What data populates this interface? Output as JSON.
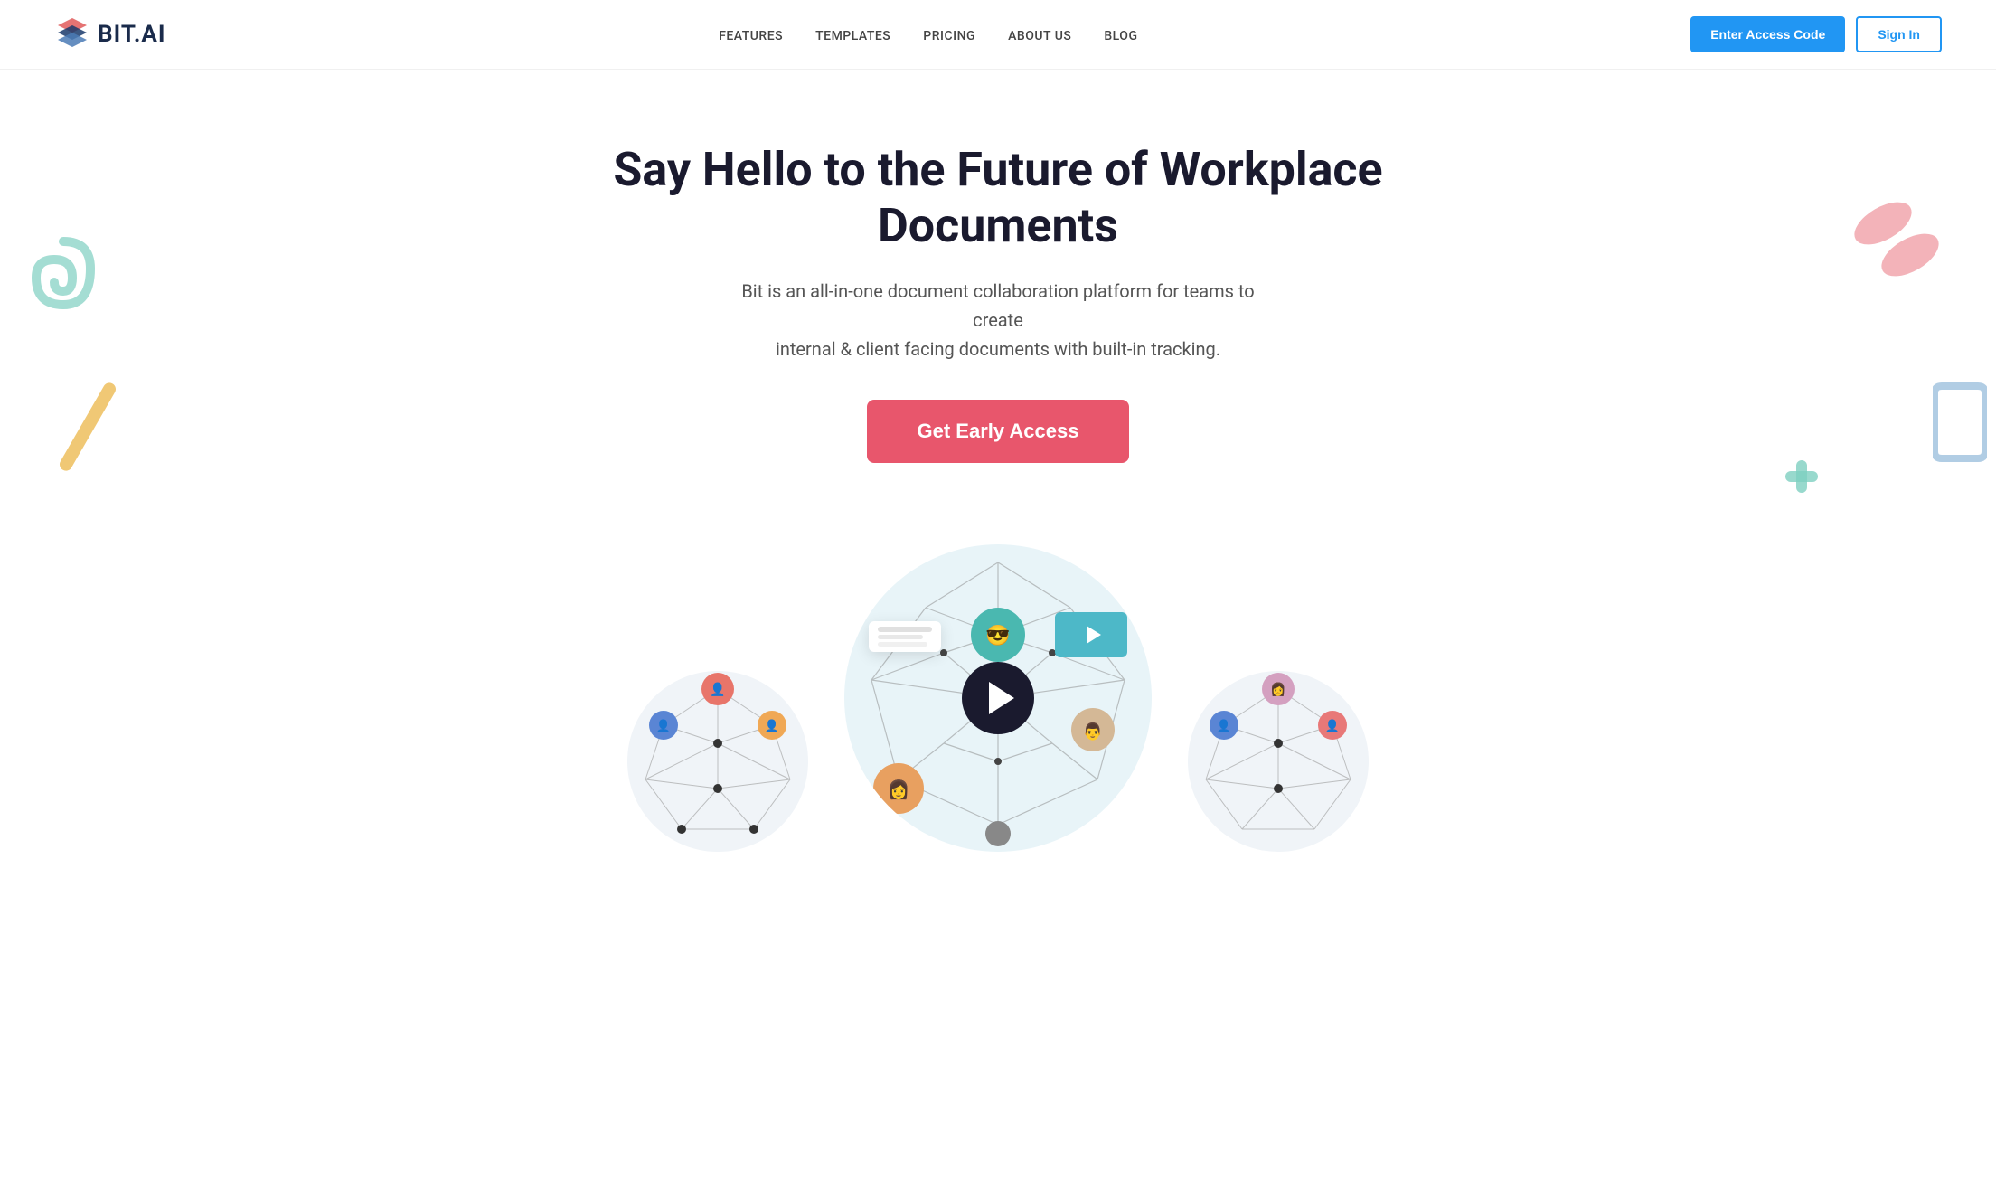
{
  "brand": {
    "logo_text": "BIT.AI",
    "tagline": "BIT.AI"
  },
  "nav": {
    "links": [
      {
        "id": "features",
        "label": "FEATURES"
      },
      {
        "id": "templates",
        "label": "TEMPLATES"
      },
      {
        "id": "pricing",
        "label": "PRICING"
      },
      {
        "id": "about",
        "label": "ABOUT US"
      },
      {
        "id": "blog",
        "label": "BLOG"
      }
    ],
    "cta_button": "Enter Access Code",
    "signin_button": "Sign In"
  },
  "hero": {
    "title": "Say Hello to the Future of Workplace Documents",
    "subtitle_line1": "Bit is an all-in-one document collaboration platform for teams to create",
    "subtitle_line2": "internal & client facing documents with built-in tracking.",
    "cta_label": "Get Early Access"
  },
  "colors": {
    "brand_blue": "#2196f3",
    "brand_dark": "#1a2b4b",
    "cta_pink": "#e8566c",
    "deco_teal": "#7ecfc0",
    "deco_yellow": "#f0c875",
    "deco_pink": "#f0a0a8",
    "deco_blue": "#90b8d8"
  }
}
